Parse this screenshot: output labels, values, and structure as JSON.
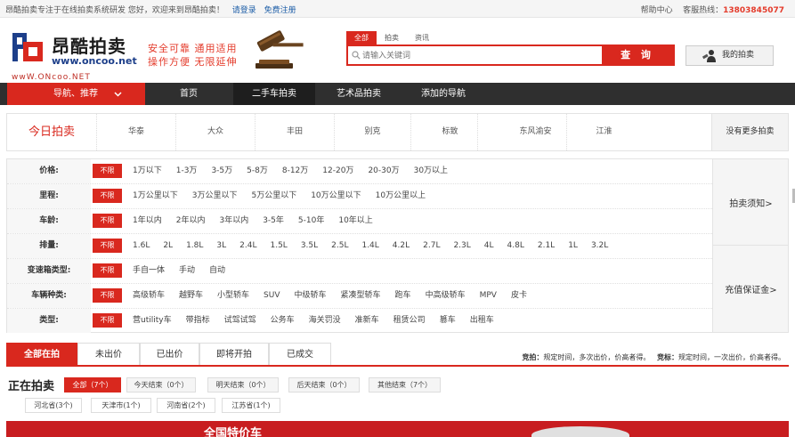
{
  "topbar": {
    "welcome": "昂酷拍卖专注于在线拍卖系统研发 您好，欢迎来到昂酷拍卖！",
    "login": "请登录",
    "register": "免费注册",
    "help": "帮助中心",
    "hotline_label": "客服热线：",
    "hotline": "13803845077"
  },
  "logo": {
    "name": "昂酷拍卖",
    "url": "www.oncoo.net",
    "url_reflection": "wwW.ONcoo.NET",
    "slogan_line1": "安全可靠  通用适用",
    "slogan_line2": "操作方便  无限延伸"
  },
  "search": {
    "tabs": [
      "全部",
      "拍卖",
      "资讯"
    ],
    "placeholder": "请输入关键词",
    "button": "查 询"
  },
  "my_auction": "我的拍卖",
  "nav": {
    "category": "导航、推荐",
    "items": [
      "首页",
      "二手车拍卖",
      "艺术品拍卖",
      "添加的导航"
    ]
  },
  "today": {
    "title": "今日拍卖",
    "brands": [
      "华泰",
      "大众",
      "丰田",
      "别克",
      "标致",
      "东风渝安",
      "江淮"
    ],
    "more": "没有更多拍卖"
  },
  "filters": {
    "any_label": "不限",
    "rows": [
      {
        "label": "价格:",
        "options": [
          "1万以下",
          "1-3万",
          "3-5万",
          "5-8万",
          "8-12万",
          "12-20万",
          "20-30万",
          "30万以上"
        ]
      },
      {
        "label": "里程:",
        "options": [
          "1万公里以下",
          "3万公里以下",
          "5万公里以下",
          "10万公里以下",
          "10万公里以上"
        ]
      },
      {
        "label": "车龄:",
        "options": [
          "1年以内",
          "2年以内",
          "3年以内",
          "3-5年",
          "5-10年",
          "10年以上"
        ]
      },
      {
        "label": "排量:",
        "options": [
          "1.6L",
          "2L",
          "1.8L",
          "3L",
          "2.4L",
          "1.5L",
          "3.5L",
          "2.5L",
          "1.4L",
          "4.2L",
          "2.7L",
          "2.3L",
          "4L",
          "4.8L",
          "2.1L",
          "1L",
          "3.2L"
        ]
      },
      {
        "label": "变速箱类型:",
        "options": [
          "手自一体",
          "手动",
          "自动"
        ]
      },
      {
        "label": "车辆种类:",
        "options": [
          "高级轿车",
          "越野车",
          "小型轿车",
          "SUV",
          "中级轿车",
          "紧凑型轿车",
          "跑车",
          "中高级轿车",
          "MPV",
          "皮卡"
        ]
      },
      {
        "label": "类型:",
        "options": [
          "营utility车",
          "带指标",
          "试驾试驾",
          "公务车",
          "海关罚没",
          "准新车",
          "租赁公司",
          "篡车",
          "出租车"
        ]
      }
    ],
    "side": [
      "拍卖须知>",
      "充值保证金>"
    ]
  },
  "status_tabs": [
    "全部在拍",
    "未出价",
    "已出价",
    "即将开拍",
    "已成交"
  ],
  "rules": {
    "jingpai_label": "竞拍：",
    "jingpai_text": "规定时间，多次出价，价高者得。",
    "jingbiao_label": "竞标：",
    "jingbiao_text": "规定时间，一次出价，价高者得。"
  },
  "in_auction": {
    "title": "正在拍卖",
    "chips": [
      "全部（7个）",
      "今天结束（0个）",
      "明天结束（0个）",
      "后天结束（0个）",
      "其他结束（7个）"
    ],
    "provinces": [
      "河北省(3个)",
      "天津市(1个)",
      "河南省(2个)",
      "江苏省(1个)"
    ]
  },
  "banner": {
    "text": "全国特价车"
  },
  "colors": {
    "accent": "#d9281e",
    "nav_bg": "#2f2f2f",
    "link": "#1f5fa8"
  }
}
